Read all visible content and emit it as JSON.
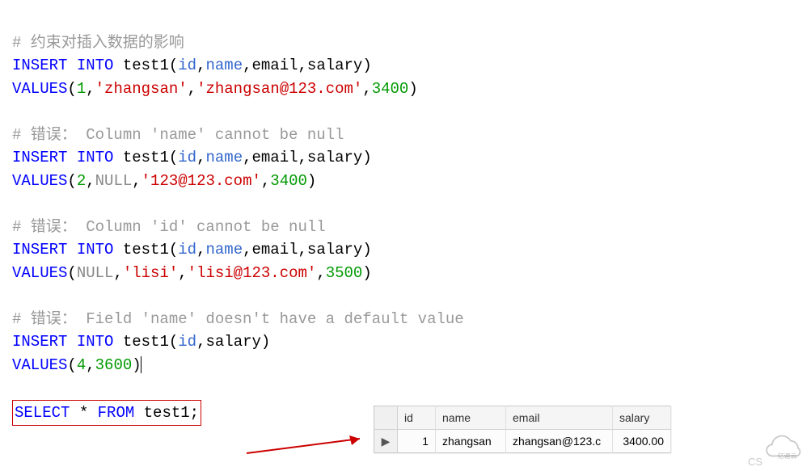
{
  "code": {
    "c1": "# 约束对插入数据的影响",
    "l2_kw1": "INSERT",
    "l2_kw1b": "INTO",
    "l2_tbl": "test1",
    "l2_id": "id",
    "l2_name": "name",
    "l2_email": "email",
    "l2_salary": "salary",
    "l3_kw": "VALUES",
    "l3_n1": "1",
    "l3_s1": "'zhangsan'",
    "l3_s2": "'zhangsan@123.com'",
    "l3_n2": "3400",
    "c2": "# 错误： Column 'name' cannot be null",
    "l5_kw1": "INSERT",
    "l5_kw1b": "INTO",
    "l5_tbl": "test1",
    "l5_id": "id",
    "l5_name": "name",
    "l5_email": "email",
    "l5_salary": "salary",
    "l6_kw": "VALUES",
    "l6_n1": "2",
    "l6_null": "NULL",
    "l6_s1": "'123@123.com'",
    "l6_n2": "3400",
    "c3": "# 错误： Column 'id' cannot be null",
    "l8_kw1": "INSERT",
    "l8_kw1b": "INTO",
    "l8_tbl": "test1",
    "l8_id": "id",
    "l8_name": "name",
    "l8_email": "email",
    "l8_salary": "salary",
    "l9_kw": "VALUES",
    "l9_null": "NULL",
    "l9_s1": "'lisi'",
    "l9_s2": "'lisi@123.com'",
    "l9_n1": "3500",
    "c4": "# 错误： Field 'name' doesn't have a default value",
    "l11_kw1": "INSERT",
    "l11_kw1b": "INTO",
    "l11_tbl": "test1",
    "l11_id": "id",
    "l11_salary": "salary",
    "l12_kw": "VALUES",
    "l12_n1": "4",
    "l12_n2": "3600",
    "sel_kw1": "SELECT",
    "sel_star": "*",
    "sel_kw2": "FROM",
    "sel_tbl": "test1"
  },
  "table": {
    "headers": {
      "h0": "",
      "h1": "id",
      "h2": "name",
      "h3": "email",
      "h4": "salary"
    },
    "row": {
      "marker": "▶",
      "id": "1",
      "name": "zhangsan",
      "email": "zhangsan@123.c",
      "salary": "3400.00"
    }
  },
  "watermark": {
    "cs": "CS",
    "cloud": "亿速云"
  }
}
